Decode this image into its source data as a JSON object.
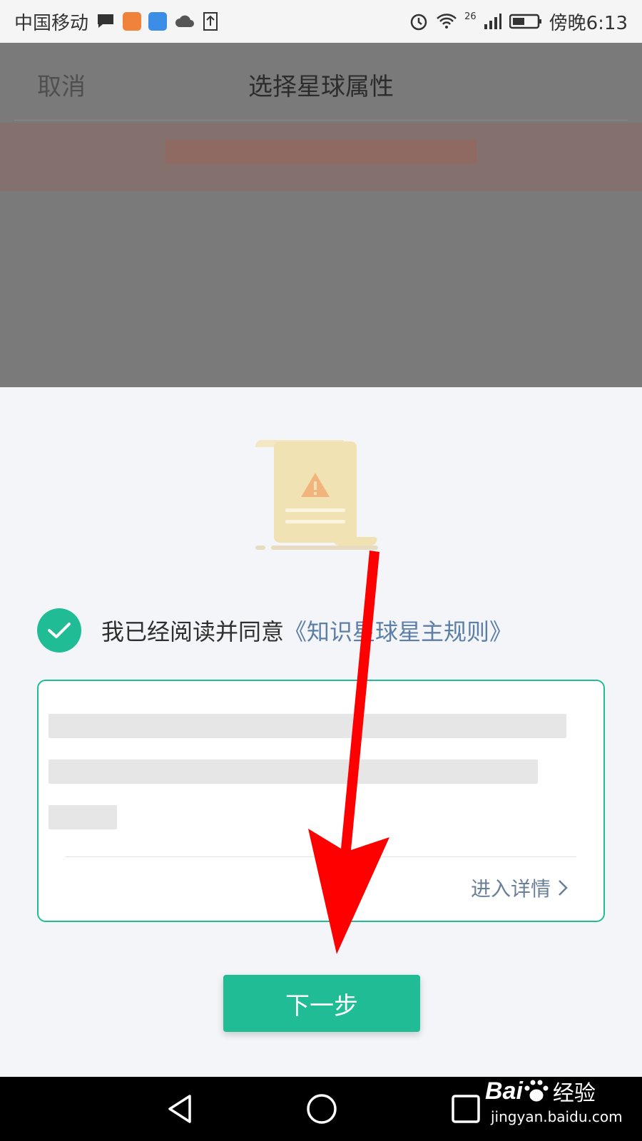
{
  "status_bar": {
    "carrier": "中国移动",
    "network": "26",
    "time": "傍晚6:13"
  },
  "header": {
    "cancel_label": "取消",
    "title": "选择星球属性"
  },
  "agreement": {
    "text": "我已经阅读并同意",
    "link_text": "《知识星球星主规则》"
  },
  "rules_box": {
    "detail_label": "进入详情"
  },
  "next_button_label": "下一步",
  "watermark": {
    "brand": "Bai",
    "brand_suffix": "经验",
    "domain": "jingyan.baidu.com"
  },
  "colors": {
    "accent": "#1fbc95",
    "link": "#5c7ea7",
    "annotation_arrow": "#ff0000"
  }
}
